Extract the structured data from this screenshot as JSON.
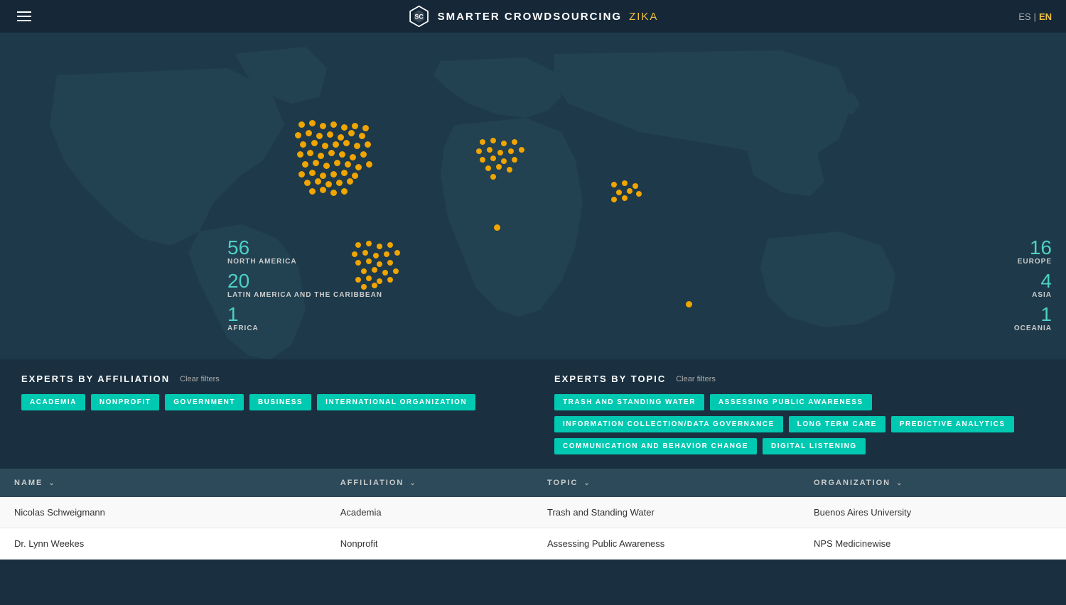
{
  "header": {
    "title": "SMARTER CROWDSOURCING",
    "subtitle": "ZIKA",
    "lang_es": "ES",
    "lang_sep": "|",
    "lang_en": "EN"
  },
  "map": {
    "regions": [
      {
        "id": "north-america",
        "num": "56",
        "label": "NORTH AMERICA"
      },
      {
        "id": "latin-america",
        "num": "20",
        "label": "LATIN AMERICA AND THE CARIBBEAN"
      },
      {
        "id": "africa",
        "num": "1",
        "label": "AFRICA"
      },
      {
        "id": "europe",
        "num": "16",
        "label": "EUROPE"
      },
      {
        "id": "asia",
        "num": "4",
        "label": "ASIA"
      },
      {
        "id": "oceania",
        "num": "1",
        "label": "OCEANIA"
      }
    ]
  },
  "affiliation_filters": {
    "title": "EXPERTS BY AFFILIATION",
    "clear_label": "Clear filters",
    "tags": [
      "ACADEMIA",
      "NONPROFIT",
      "GOVERNMENT",
      "BUSINESS",
      "INTERNATIONAL ORGANIZATION"
    ]
  },
  "topic_filters": {
    "title": "EXPERTS BY TOPIC",
    "clear_label": "Clear filters",
    "tags": [
      "TRASH AND STANDING WATER",
      "ASSESSING PUBLIC AWARENESS",
      "INFORMATION COLLECTION/DATA GOVERNANCE",
      "LONG TERM CARE",
      "PREDICTIVE ANALYTICS",
      "COMMUNICATION AND BEHAVIOR CHANGE",
      "DIGITAL LISTENING"
    ]
  },
  "table": {
    "columns": [
      {
        "id": "name",
        "label": "NAME"
      },
      {
        "id": "affiliation",
        "label": "AFFILIATION"
      },
      {
        "id": "topic",
        "label": "TOPIC"
      },
      {
        "id": "organization",
        "label": "ORGANIZATION"
      }
    ],
    "rows": [
      {
        "name": "Nicolas Schweigmann",
        "affiliation": "Academia",
        "topic": "Trash and Standing Water",
        "organization": "Buenos Aires University"
      },
      {
        "name": "Dr. Lynn Weekes",
        "affiliation": "Nonprofit",
        "topic": "Assessing Public Awareness",
        "organization": "NPS Medicinewise"
      }
    ]
  }
}
